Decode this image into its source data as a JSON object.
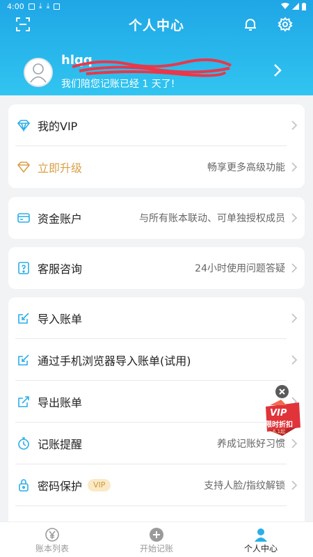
{
  "status": {
    "time": "4:00"
  },
  "header": {
    "title": "个人中心"
  },
  "profile": {
    "username": "hlqq",
    "subtitle": "我们陪您记账已经 1 天了!"
  },
  "cards": {
    "vip": {
      "my_vip": "我的VIP",
      "upgrade": "立即升级",
      "upgrade_desc": "畅享更多高级功能"
    },
    "fund": {
      "label": "资金账户",
      "desc": "与所有账本联动、可单独授权成员"
    },
    "service": {
      "label": "客服咨询",
      "desc": "24小时使用问题答疑"
    },
    "tools": {
      "import": "导入账单",
      "browser_import": "通过手机浏览器导入账单(试用)",
      "export": "导出账单",
      "reminder": "记账提醒",
      "reminder_desc": "养成记账好习惯",
      "password": "密码保护",
      "password_badge": "VIP",
      "password_desc": "支持人脸/指纹解锁"
    }
  },
  "promo": {
    "line1": "VIP",
    "line2": "限时折扣",
    "line3": "6.1起"
  },
  "tabs": [
    {
      "label": "账本列表"
    },
    {
      "label": "开始记账"
    },
    {
      "label": "个人中心"
    }
  ],
  "colors": {
    "accent": "#2aaee8",
    "vip_gold": "#d9a04a",
    "promo_red": "#e0343a"
  }
}
